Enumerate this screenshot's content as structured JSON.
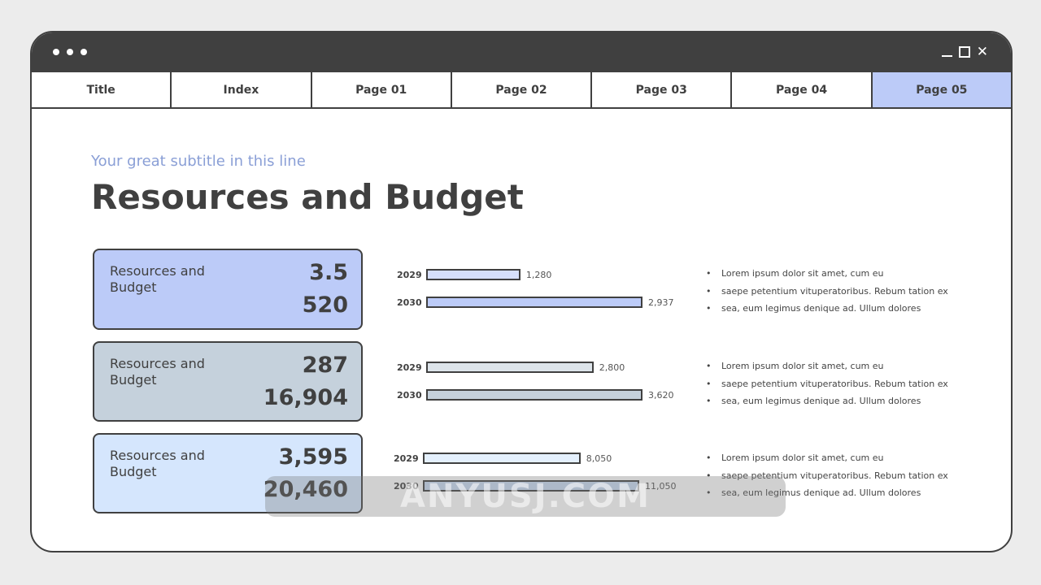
{
  "window": {
    "controls": [
      "minimize-icon",
      "maximize-icon",
      "close-icon"
    ]
  },
  "tabs": [
    {
      "label": "Title"
    },
    {
      "label": "Index"
    },
    {
      "label": "Page 01"
    },
    {
      "label": "Page 02"
    },
    {
      "label": "Page 03"
    },
    {
      "label": "Page 04"
    },
    {
      "label": "Page 05",
      "active": true
    }
  ],
  "slide": {
    "subtitle": "Your great subtitle in this line",
    "title": "Resources and Budget",
    "rows": [
      {
        "card": {
          "label": "Resources and Budget",
          "value1": "3.5",
          "value2": "520",
          "color": "#bccbf8"
        },
        "bars": [
          {
            "year": "2029",
            "value": 1280,
            "label": "1,280",
            "color": "#d6dffb"
          },
          {
            "year": "2030",
            "value": 2937,
            "label": "2,937",
            "color": "#bccbf8"
          }
        ],
        "bullets": [
          "Lorem ipsum dolor sit amet, cum eu",
          "saepe petentium vituperatoribus. Rebum tation ex",
          "sea, eum legimus denique ad. Ullum dolores"
        ]
      },
      {
        "card": {
          "label": "Resources and Budget",
          "value1": "287",
          "value2": "16,904",
          "color": "#c5d1dc"
        },
        "bars": [
          {
            "year": "2029",
            "value": 2800,
            "label": "2,800",
            "color": "#dde4ea"
          },
          {
            "year": "2030",
            "value": 3620,
            "label": "3,620",
            "color": "#c5d1dc"
          }
        ],
        "bullets": [
          "Lorem ipsum dolor sit amet, cum eu",
          "saepe petentium vituperatoribus. Rebum tation ex",
          "sea, eum legimus denique ad. Ullum dolores"
        ]
      },
      {
        "card": {
          "label": "Resources and Budget",
          "value1": "3,595",
          "value2": "20,460",
          "color": "#d5e6fd"
        },
        "bars": [
          {
            "year": "2029",
            "value": 8050,
            "label": "8,050",
            "color": "#e4f0fd"
          },
          {
            "year": "2030",
            "value": 11050,
            "label": "11,050",
            "color": "#c9dcf5"
          }
        ],
        "bullets": [
          "Lorem ipsum dolor sit amet, cum eu",
          "saepe petentium vituperatoribus. Rebum tation ex",
          "sea, eum legimus denique ad. Ullum dolores"
        ]
      }
    ]
  },
  "watermark": "ANYUSJ.COM"
}
